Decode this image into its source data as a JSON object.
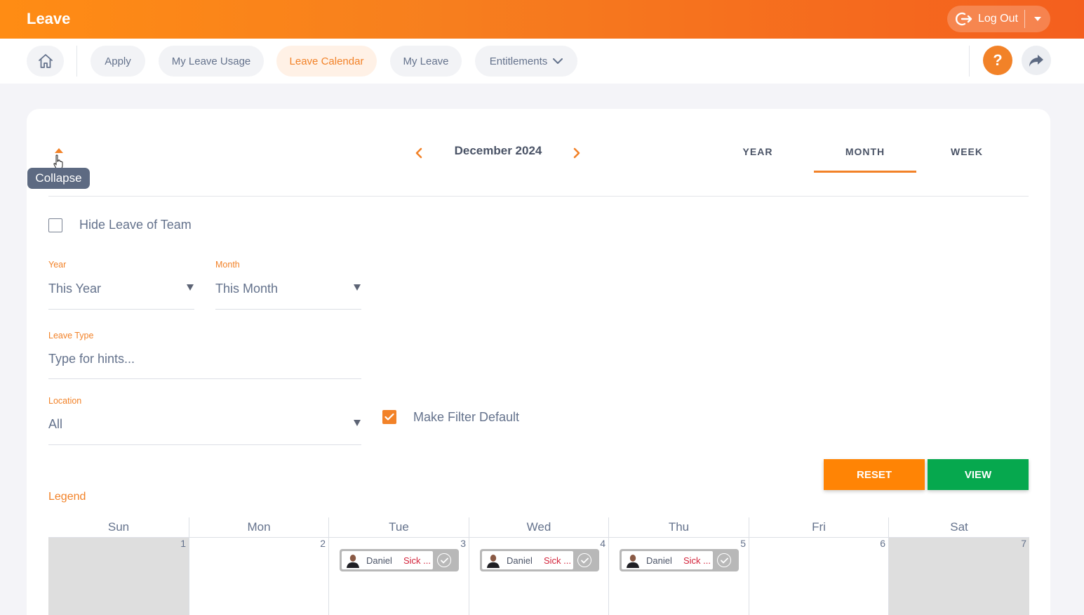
{
  "app": {
    "title": "Leave"
  },
  "header": {
    "logout_label": "Log Out",
    "logout_icon": "logout-icon",
    "dropdown_icon": "caret-down-icon"
  },
  "nav": {
    "home_icon": "home-icon",
    "items": [
      {
        "label": "Apply",
        "active": false
      },
      {
        "label": "My Leave Usage",
        "active": false
      },
      {
        "label": "Leave Calendar",
        "active": true
      },
      {
        "label": "My Leave",
        "active": false
      },
      {
        "label": "Entitlements",
        "active": false,
        "has_dropdown": true
      }
    ],
    "help_label": "?",
    "share_icon": "share-icon"
  },
  "calendar_header": {
    "collapse_tooltip": "Collapse",
    "month_title": "December 2024",
    "views": [
      "YEAR",
      "MONTH",
      "WEEK"
    ],
    "active_view": "MONTH"
  },
  "filters": {
    "hide_team_label": "Hide Leave of Team",
    "hide_team_checked": false,
    "year": {
      "label": "Year",
      "value": "This Year"
    },
    "month": {
      "label": "Month",
      "value": "This Month"
    },
    "leave_type": {
      "label": "Leave Type",
      "placeholder": "Type for hints..."
    },
    "location": {
      "label": "Location",
      "value": "All"
    },
    "make_default_label": "Make Filter Default",
    "make_default_checked": true,
    "reset_label": "RESET",
    "view_label": "VIEW"
  },
  "legend_label": "Legend",
  "calendar": {
    "weekdays": [
      "Sun",
      "Mon",
      "Tue",
      "Wed",
      "Thu",
      "Fri",
      "Sat"
    ],
    "days": [
      {
        "num": "1",
        "weekend": true
      },
      {
        "num": "2",
        "weekend": false
      },
      {
        "num": "3",
        "weekend": false,
        "event": {
          "name": "Daniel",
          "type": "Sick ..."
        }
      },
      {
        "num": "4",
        "weekend": false,
        "event": {
          "name": "Daniel",
          "type": "Sick ..."
        }
      },
      {
        "num": "5",
        "weekend": false,
        "event": {
          "name": "Daniel",
          "type": "Sick ..."
        }
      },
      {
        "num": "6",
        "weekend": false
      },
      {
        "num": "7",
        "weekend": true
      }
    ]
  },
  "colors": {
    "accent": "#f28228",
    "view_button": "#06a84e",
    "reset_button": "#ff8405",
    "sick": "#d3233a"
  }
}
